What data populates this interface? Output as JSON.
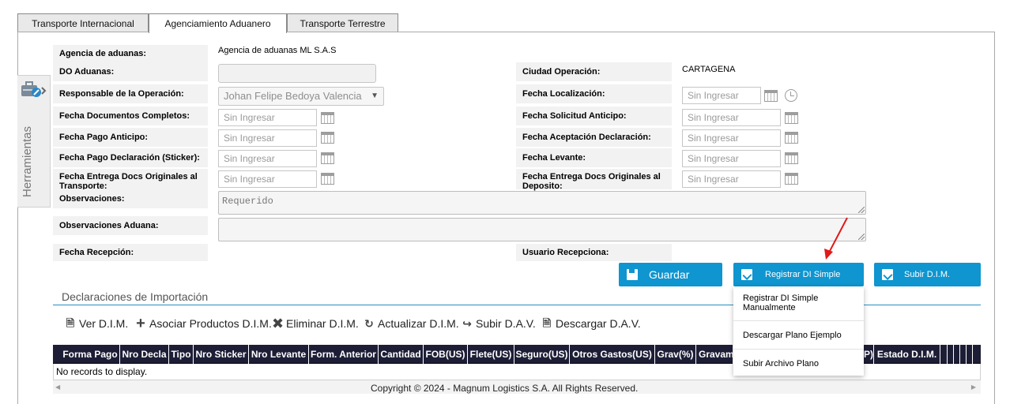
{
  "tabs": [
    {
      "label": "Transporte Internacional",
      "active": false
    },
    {
      "label": "Agenciamiento Aduanero",
      "active": true
    },
    {
      "label": "Transporte Terrestre",
      "active": false
    }
  ],
  "sidebar": {
    "label": "Herramientas",
    "icon": "toolbox-icon"
  },
  "form": {
    "agencia_label": "Agencia de aduanas:",
    "agencia_value": "Agencia de aduanas ML S.A.S",
    "do_label": "DO Aduanas:",
    "ciudad_label": "Ciudad Operación:",
    "ciudad_value": "CARTAGENA",
    "responsable_label": "Responsable de la Operación:",
    "responsable_value": "Johan Felipe Bedoya Valencia",
    "fecha_localizacion_label": "Fecha Localización:",
    "fecha_docs_completos_label": "Fecha Documentos Completos:",
    "fecha_solicitud_anticipo_label": "Fecha Solicitud Anticipo:",
    "fecha_pago_anticipo_label": "Fecha Pago Anticipo:",
    "fecha_aceptacion_label": "Fecha Aceptación Declaración:",
    "fecha_pago_declaracion_label": "Fecha Pago Declaración (Sticker):",
    "fecha_levante_label": "Fecha Levante:",
    "fecha_entrega_transporte_label": "Fecha Entrega Docs Originales al Transporte:",
    "fecha_entrega_deposito_label": "Fecha Entrega Docs Originales al Deposito:",
    "observaciones_label": "Observaciones:",
    "observaciones_placeholder": "Requerido",
    "observaciones_aduana_label": "Observaciones Aduana:",
    "fecha_recepcion_label": "Fecha Recepción:",
    "usuario_recepciona_label": "Usuario Recepciona:",
    "date_placeholder": "Sin Ingresar"
  },
  "buttons": {
    "guardar": "Guardar",
    "registrar_di_simple": "Registrar DI Simple",
    "subir_dim": "Subir D.I.M."
  },
  "dropdown": {
    "items": [
      "Registrar DI Simple Manualmente",
      "Descargar Plano Ejemplo",
      "Subir Archivo Plano"
    ]
  },
  "section": {
    "title": "Declaraciones de Importación"
  },
  "toolbar": {
    "ver_dim": "Ver D.I.M.",
    "asociar": "Asociar Productos D.I.M.",
    "eliminar": "Eliminar D.I.M.",
    "actualizar": "Actualizar D.I.M.",
    "subir_dav": "Subir D.A.V.",
    "descargar_dav": "Descargar D.A.V."
  },
  "grid": {
    "columns": [
      "Forma Pago",
      "Nro Decla",
      "Tipo",
      "Nro Sticker",
      "Nro Levante",
      "Form. Anterior",
      "Cantidad",
      "FOB(US)",
      "Flete(US)",
      "Seguro(US)",
      "Otros Gastos(US)",
      "Grav(%)",
      "Gravam",
      "P)",
      "Estado D.I.M."
    ],
    "empty_text": "No records to display."
  },
  "footer": {
    "copyright": "Copyright © 2024 - Magnum Logistics S.A. All Rights Reserved."
  },
  "colors": {
    "accent": "#0f95cf",
    "grid_header": "#1d1e36",
    "annotation_arrow": "#e01a1a"
  }
}
